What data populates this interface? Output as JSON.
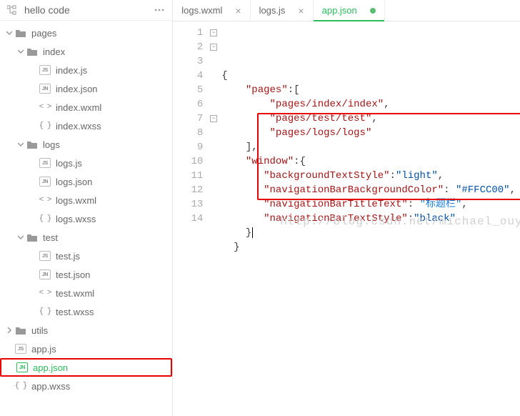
{
  "sidebar": {
    "project_title": "hello code",
    "tree": [
      {
        "depth": 0,
        "type": "folder",
        "open": true,
        "name": "pages",
        "icon": "folder"
      },
      {
        "depth": 1,
        "type": "folder",
        "open": true,
        "name": "index",
        "icon": "folder"
      },
      {
        "depth": 2,
        "type": "file",
        "name": "index.js",
        "icon": "js"
      },
      {
        "depth": 2,
        "type": "file",
        "name": "index.json",
        "icon": "jn"
      },
      {
        "depth": 2,
        "type": "file",
        "name": "index.wxml",
        "icon": "angle"
      },
      {
        "depth": 2,
        "type": "file",
        "name": "index.wxss",
        "icon": "curly"
      },
      {
        "depth": 1,
        "type": "folder",
        "open": true,
        "name": "logs",
        "icon": "folder"
      },
      {
        "depth": 2,
        "type": "file",
        "name": "logs.js",
        "icon": "js"
      },
      {
        "depth": 2,
        "type": "file",
        "name": "logs.json",
        "icon": "jn"
      },
      {
        "depth": 2,
        "type": "file",
        "name": "logs.wxml",
        "icon": "angle"
      },
      {
        "depth": 2,
        "type": "file",
        "name": "logs.wxss",
        "icon": "curly"
      },
      {
        "depth": 1,
        "type": "folder",
        "open": true,
        "name": "test",
        "icon": "folder"
      },
      {
        "depth": 2,
        "type": "file",
        "name": "test.js",
        "icon": "js"
      },
      {
        "depth": 2,
        "type": "file",
        "name": "test.json",
        "icon": "jn"
      },
      {
        "depth": 2,
        "type": "file",
        "name": "test.wxml",
        "icon": "angle"
      },
      {
        "depth": 2,
        "type": "file",
        "name": "test.wxss",
        "icon": "curly"
      },
      {
        "depth": 0,
        "type": "folder",
        "open": false,
        "name": "utils",
        "icon": "folder"
      },
      {
        "depth": 0,
        "type": "file",
        "name": "app.js",
        "icon": "js"
      },
      {
        "depth": 0,
        "type": "file",
        "name": "app.json",
        "icon": "jn",
        "active": true,
        "highlight": true
      },
      {
        "depth": 0,
        "type": "file",
        "name": "app.wxss",
        "icon": "curly"
      }
    ]
  },
  "tabs": [
    {
      "label": "logs.wxml",
      "active": false,
      "dirty": false
    },
    {
      "label": "logs.js",
      "active": false,
      "dirty": false
    },
    {
      "label": "app.json",
      "active": true,
      "dirty": true
    }
  ],
  "code": {
    "line_numbers": [
      "1",
      "2",
      "3",
      "4",
      "5",
      "6",
      "7",
      "8",
      "9",
      "10",
      "11",
      "12",
      "13",
      "14"
    ],
    "folds": {
      "1": "minus",
      "2": "minus",
      "7": "minus"
    },
    "lines": [
      [
        {
          "t": "{",
          "c": "brace"
        }
      ],
      [
        {
          "t": "    ",
          "c": ""
        },
        {
          "t": "\"pages\"",
          "c": "key"
        },
        {
          "t": ":[",
          "c": "punc"
        }
      ],
      [
        {
          "t": "        ",
          "c": ""
        },
        {
          "t": "\"pages/index/index\"",
          "c": "key"
        },
        {
          "t": ",",
          "c": "punc"
        }
      ],
      [
        {
          "t": "        ",
          "c": ""
        },
        {
          "t": "\"pages/test/test\"",
          "c": "key"
        },
        {
          "t": ",",
          "c": "punc"
        }
      ],
      [
        {
          "t": "        ",
          "c": ""
        },
        {
          "t": "\"pages/logs/logs\"",
          "c": "key"
        }
      ],
      [
        {
          "t": "    ",
          "c": ""
        },
        {
          "t": "],",
          "c": "punc"
        }
      ],
      [
        {
          "t": "    ",
          "c": ""
        },
        {
          "t": "\"window\"",
          "c": "key"
        },
        {
          "t": ":{",
          "c": "punc"
        }
      ],
      [
        {
          "t": "       ",
          "c": ""
        },
        {
          "t": "\"backgroundTextStyle\"",
          "c": "key"
        },
        {
          "t": ":",
          "c": "punc"
        },
        {
          "t": "\"light\"",
          "c": "val"
        },
        {
          "t": ",",
          "c": "punc"
        }
      ],
      [
        {
          "t": "       ",
          "c": ""
        },
        {
          "t": "\"navigationBarBackgroundColor\"",
          "c": "key"
        },
        {
          "t": ": ",
          "c": "punc"
        },
        {
          "t": "\"#FFCC00\"",
          "c": "val"
        },
        {
          "t": ",",
          "c": "punc"
        }
      ],
      [
        {
          "t": "       ",
          "c": ""
        },
        {
          "t": "\"navigationBarTitleText\"",
          "c": "key"
        },
        {
          "t": ": ",
          "c": "punc"
        },
        {
          "t": "\"标题栏\"",
          "c": "cn"
        },
        {
          "t": ",",
          "c": "punc"
        }
      ],
      [
        {
          "t": "       ",
          "c": ""
        },
        {
          "t": "\"navigationBarTextStyle\"",
          "c": "key"
        },
        {
          "t": ":",
          "c": "punc"
        },
        {
          "t": "\"black\"",
          "c": "val"
        }
      ],
      [
        {
          "t": "    ",
          "c": ""
        },
        {
          "t": "}",
          "c": "brace"
        },
        {
          "t": "|",
          "c": "cursor"
        }
      ],
      [
        {
          "t": "  ",
          "c": ""
        },
        {
          "t": "}",
          "c": "brace"
        }
      ],
      []
    ]
  },
  "watermark": "http://blog.csdn.net/michael_ouyang"
}
